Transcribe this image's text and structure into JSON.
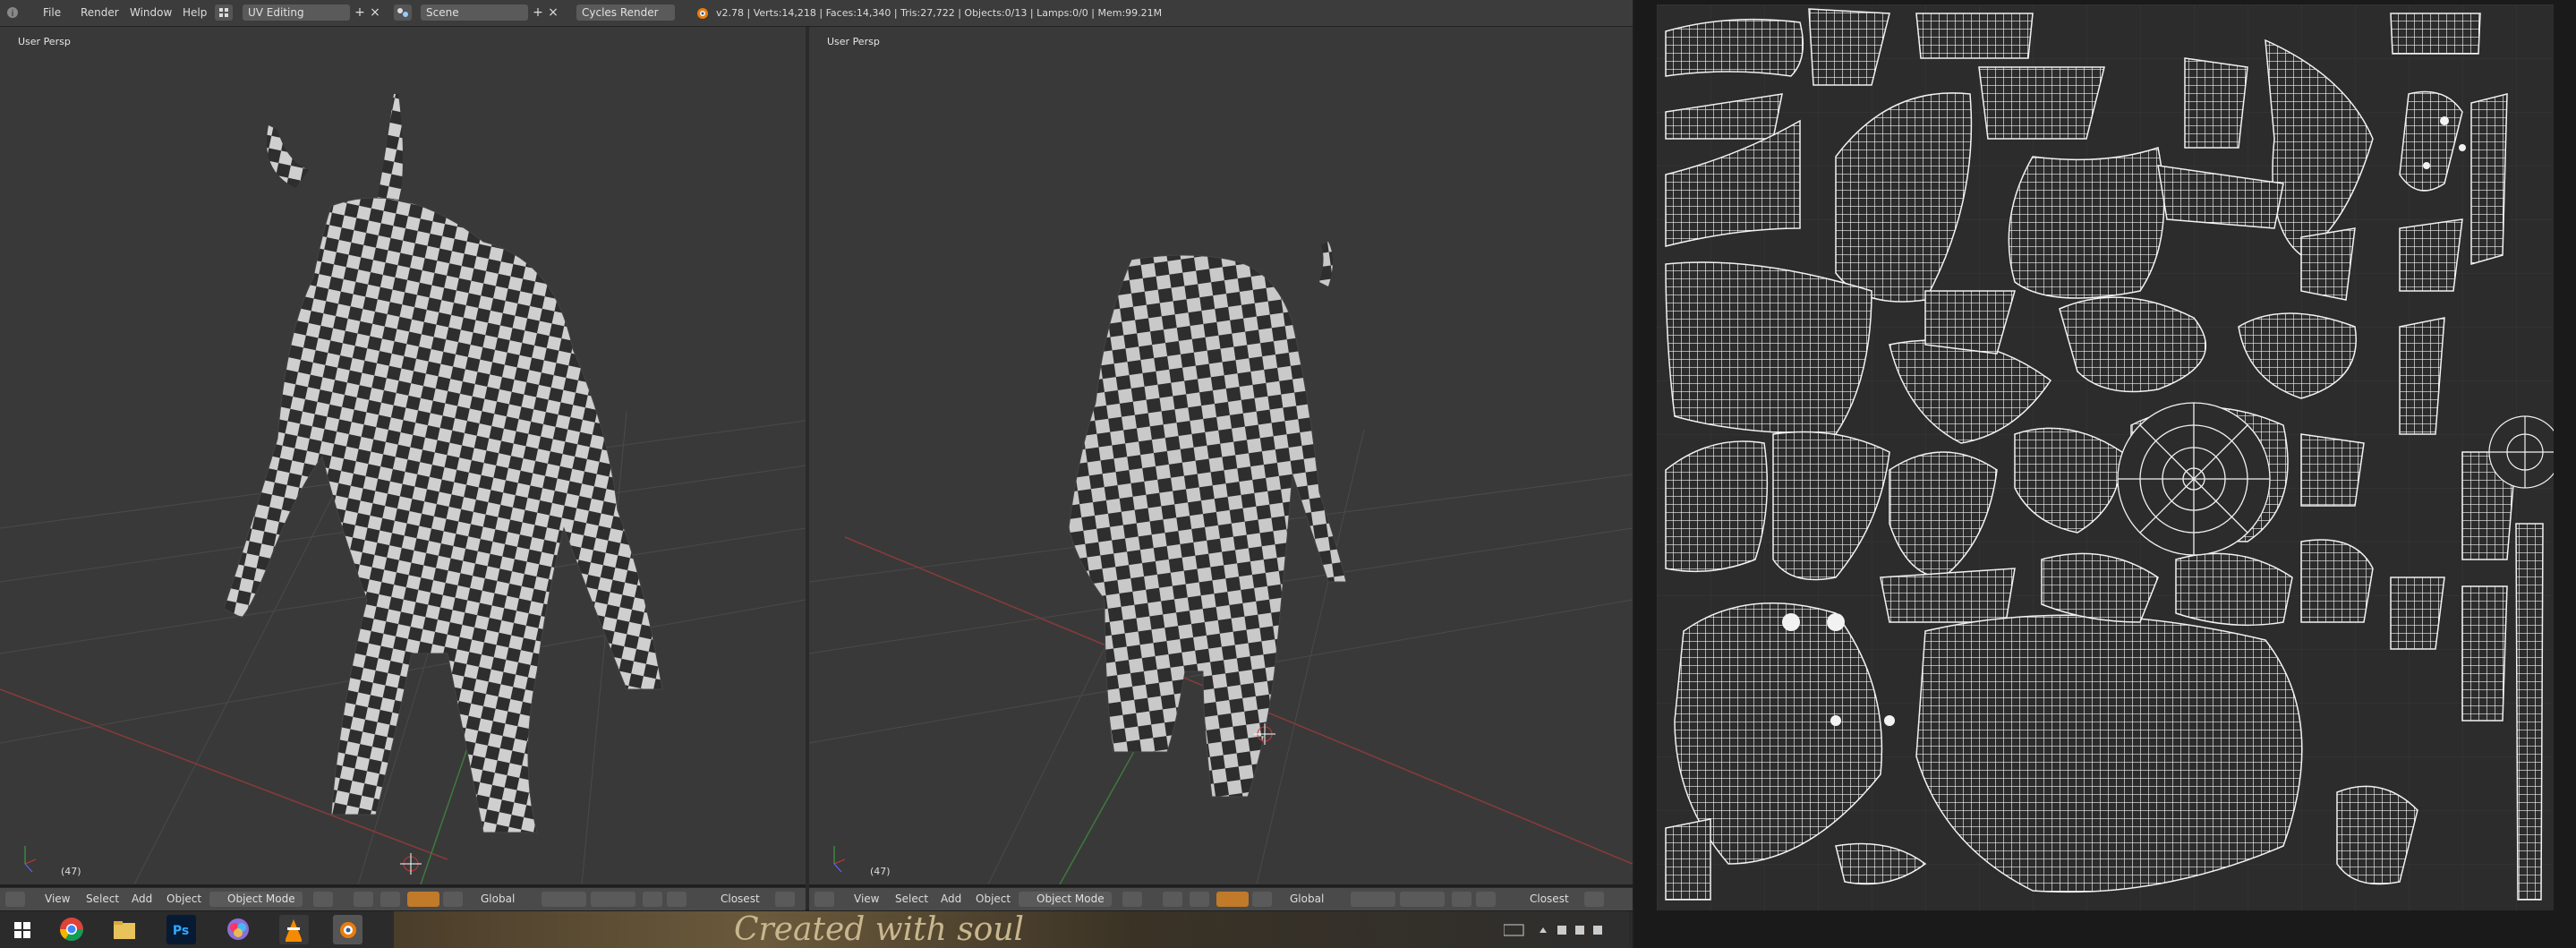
{
  "topbar": {
    "menus": [
      "File",
      "Render",
      "Window",
      "Help"
    ],
    "screen_layout": "UV Editing",
    "scene": "Scene",
    "render_engine": "Cycles Render",
    "stats": "v2.78 | Verts:14,218 | Faces:14,340 | Tris:27,722 | Objects:0/13 | Lamps:0/0 | Mem:99.21M"
  },
  "viewports": [
    {
      "label": "User Persp",
      "frame": "(47)"
    },
    {
      "label": "User Persp",
      "frame": "(47)"
    }
  ],
  "header3d": {
    "menus": [
      "View",
      "Select",
      "Add",
      "Object"
    ],
    "mode": "Object Mode",
    "orientation": "Global",
    "snap": "Closest"
  },
  "taskbar": {
    "banner_text": "Created with soul",
    "apps": [
      "windows-start",
      "chrome",
      "file-explorer",
      "photoshop",
      "color-app",
      "vlc",
      "blender"
    ]
  },
  "colors": {
    "viewport_bg": "#393939",
    "uv_bg": "#2c2c2c",
    "accent": "#e87d0d"
  }
}
